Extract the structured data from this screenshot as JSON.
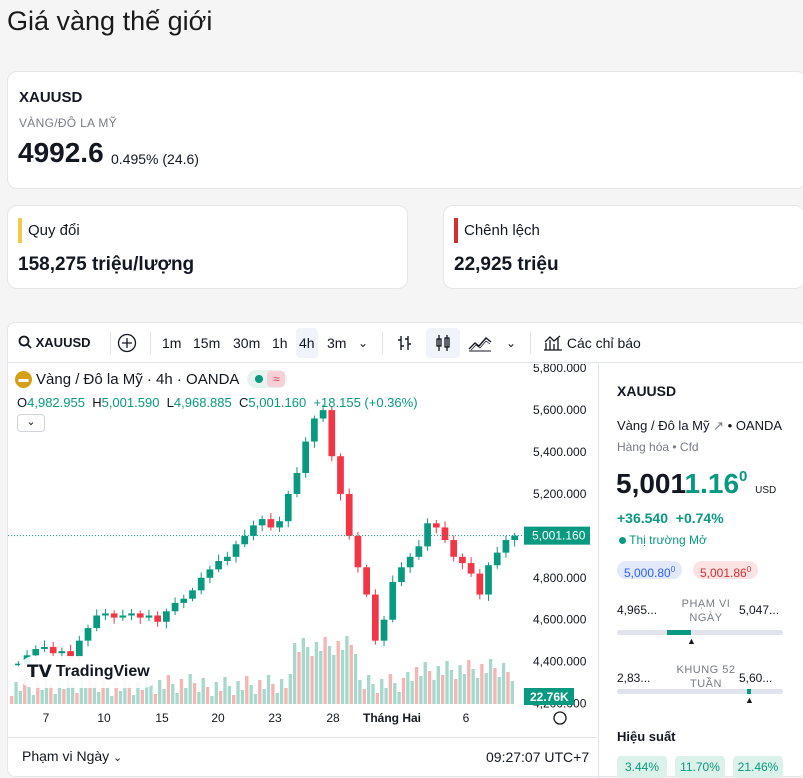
{
  "page": {
    "title": "Giá vàng thế giới"
  },
  "quote": {
    "symbol": "XAUUSD",
    "description": "VÀNG/ĐÔ LA MỸ",
    "price": "4992.6",
    "change": "0.495% (24.6)"
  },
  "cards": {
    "convert": {
      "label": "Quy đổi",
      "value": "158,275 triệu/lượng",
      "accent": "#f2c94c"
    },
    "spread": {
      "label": "Chênh lệch",
      "value": "22,925 triệu",
      "accent": "#d32f2f"
    }
  },
  "toolbar": {
    "symbol": "XAUUSD",
    "intervals": [
      "1m",
      "15m",
      "30m",
      "1h",
      "4h",
      "3m"
    ],
    "selected_interval": "4h",
    "indicators_label": "Các chỉ báo"
  },
  "chart_header": {
    "title": "Vàng / Đô la Mỹ · 4h · OANDA",
    "O": "4,982.955",
    "H": "5,001.590",
    "L": "4,968.885",
    "C": "5,001.160",
    "change": "+18.155 (+0.36%)"
  },
  "chart_data": {
    "type": "candlestick",
    "y_ticks": [
      "5,800.000",
      "5,600.000",
      "5,400.000",
      "5,200.000",
      "4,800.000",
      "4,600.000",
      "4,400.000",
      "4,200.000"
    ],
    "x_ticks": [
      "7",
      "10",
      "15",
      "20",
      "23",
      "28",
      "Tháng Hai",
      "6"
    ],
    "ylim": [
      4150,
      5820
    ],
    "last_price_label": "5,001.160",
    "volume_label": "22.76K",
    "close_path": [
      4390,
      4430,
      4460,
      4470,
      4440,
      4450,
      4420,
      4500,
      4560,
      4620,
      4630,
      4610,
      4620,
      4630,
      4610,
      4620,
      4590,
      4640,
      4680,
      4700,
      4740,
      4800,
      4840,
      4880,
      4900,
      4960,
      5000,
      5050,
      5080,
      5040,
      5070,
      5200,
      5300,
      5450,
      5560,
      5600,
      5380,
      5200,
      5000,
      4850,
      4720,
      4500,
      4600,
      4780,
      4850,
      4900,
      4950,
      5060,
      5040,
      4980,
      4900,
      4870,
      4820,
      4720,
      4860,
      4920,
      4980,
      5001
    ]
  },
  "watermark": "TradingView",
  "footer": {
    "range": "Phạm vi Ngày",
    "time": "09:27:07 UTC+7"
  },
  "side": {
    "symbol": "XAUUSD",
    "desc": "Vàng / Đô la Mỹ",
    "exchange": "OANDA",
    "category": "Hàng hóa",
    "type": "Cfd",
    "price_main": "5,001",
    "price_dec": "1.16",
    "price_sup": "0",
    "currency": "USD",
    "change": "+36.540",
    "change_pct": "+0.74%",
    "market_status": "Thị trường Mở",
    "bid": "5,000.80",
    "bid_sup": "0",
    "ask": "5,001.86",
    "ask_sup": "0",
    "day_low": "4,965...",
    "day_high": "5,047...",
    "day_label": "PHẠM VI NGÀY",
    "day_level": 0.48,
    "wk_low": "2,83...",
    "wk_high": "5,60...",
    "wk_label": "KHUNG 52 TUẦN",
    "wk_level": 0.8,
    "perf_title": "Hiệu suất",
    "perf": [
      "3.44%",
      "11.70%",
      "21.46%"
    ]
  }
}
